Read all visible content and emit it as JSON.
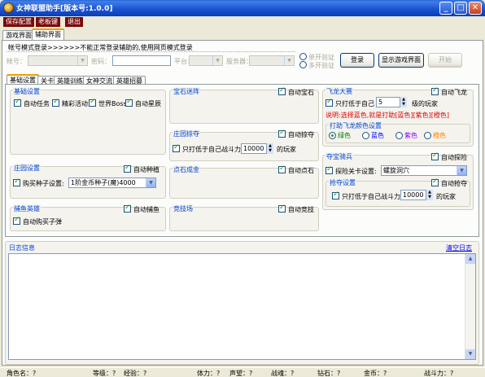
{
  "window": {
    "title": "女神联盟助手[版本号:1.0.0]",
    "min": "_",
    "max": "□",
    "close": "✕"
  },
  "menu": [
    "保存配置",
    "老板键",
    "退出"
  ],
  "main_tabs": [
    "游戏界面",
    "辅助界面"
  ],
  "login": {
    "title": "帐号模式登录>>>>>>不能正常登录辅助的,使用网页模式登录",
    "account_label": "帐号：",
    "password_label": "密码：",
    "platform_label": "平台：",
    "server_label": "服务器：",
    "single_verify": "单开验证",
    "multi_verify": "多开验证",
    "login_btn": "登录",
    "show_game_btn": "显示游戏界面",
    "start_btn": "开始"
  },
  "sub_tabs": [
    "基础设置",
    "关卡",
    "英雄训练",
    "女神交流",
    "英雄招募"
  ],
  "basic": {
    "title": "基础设置",
    "items": [
      "自动任务",
      "精彩活动",
      "世界Boss",
      "自动星辰"
    ]
  },
  "manor": {
    "title": "庄园设置",
    "auto_plant": "自动种植",
    "buy_seed": "购买种子设置:",
    "seed_value": "1阶金币种子(魔)4000"
  },
  "fishing": {
    "title": "捕鱼英雄",
    "auto_fish": "自动捕鱼",
    "auto_bait": "自动购买子弹"
  },
  "gem": {
    "title": "宝石迷阵",
    "auto": "自动宝石"
  },
  "plunder": {
    "title": "庄园掠夺",
    "auto": "自动掠夺",
    "only_lower": "只打低于自己战斗力",
    "power": "10000",
    "suffix": "的玩家"
  },
  "stone": {
    "title": "点石成金",
    "auto": "自动点石"
  },
  "arena": {
    "title": "竞技场",
    "auto": "自动竞技"
  },
  "dragon": {
    "title": "飞龙大赛",
    "auto": "自动飞龙",
    "only_lower": "只打低于自己",
    "level": "5",
    "suffix": "级的玩家",
    "note": "说明:选择蓝色,就是打助[蓝色][紫色][橙色]",
    "color_title": "打助飞龙颜色设置",
    "colors": [
      "绿色",
      "蓝色",
      "紫色",
      "橙色"
    ]
  },
  "treasure": {
    "title": "夺宝骑兵",
    "auto": "自动探险",
    "set_label": "探险关卡设置:",
    "set_value": "螺旋洞穴",
    "rob_title": "抢夺设置",
    "rob_auto": "自动抢夺",
    "only_lower": "只打低于自己战斗力",
    "power": "10000",
    "suffix": "的玩家"
  },
  "log": {
    "title": "日志信息",
    "clear": "清空日志"
  },
  "status": {
    "role": "角色名：?",
    "level": "等级：?",
    "exp": "经验：?",
    "stamina": "体力：?",
    "fame": "声望：?",
    "soul": "战魂：?",
    "diamond": "钻石：?",
    "gold": "金币：?",
    "power": "战斗力：?"
  }
}
